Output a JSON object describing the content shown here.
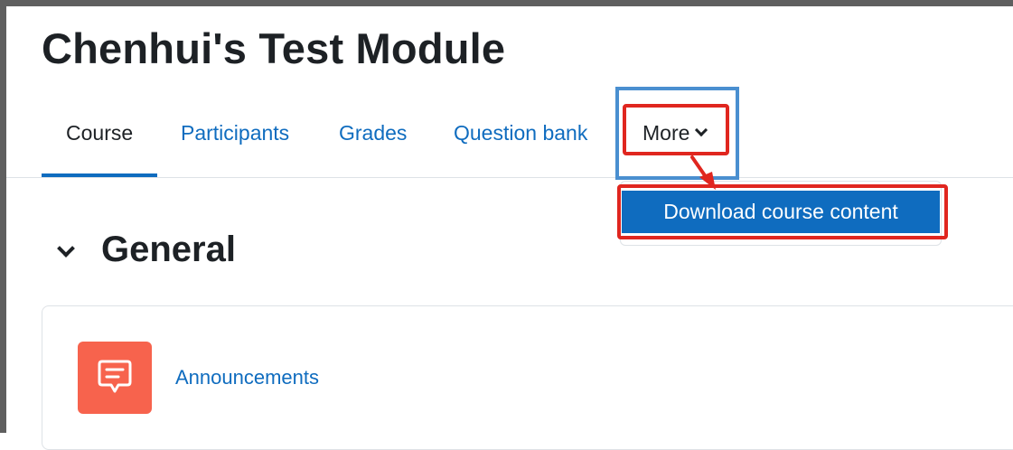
{
  "page": {
    "title": "Chenhui's Test Module"
  },
  "nav": {
    "tabs": [
      {
        "label": "Course",
        "active": true
      },
      {
        "label": "Participants",
        "active": false
      },
      {
        "label": "Grades",
        "active": false
      },
      {
        "label": "Question bank",
        "active": false
      }
    ],
    "more": {
      "label": "More",
      "icon": "chevron-down-icon",
      "menu_items": [
        {
          "label": "Download course content",
          "highlighted": true
        }
      ]
    }
  },
  "section": {
    "title": "General",
    "icon": "chevron-down-icon",
    "activities": [
      {
        "label": "Announcements",
        "icon": "forum-icon",
        "icon_color": "#f7634d"
      }
    ]
  },
  "colors": {
    "accent": "#0f6cbf",
    "annotation_red": "#e0261f",
    "annotation_blue": "#4a8fd0",
    "text": "#1d2125"
  }
}
